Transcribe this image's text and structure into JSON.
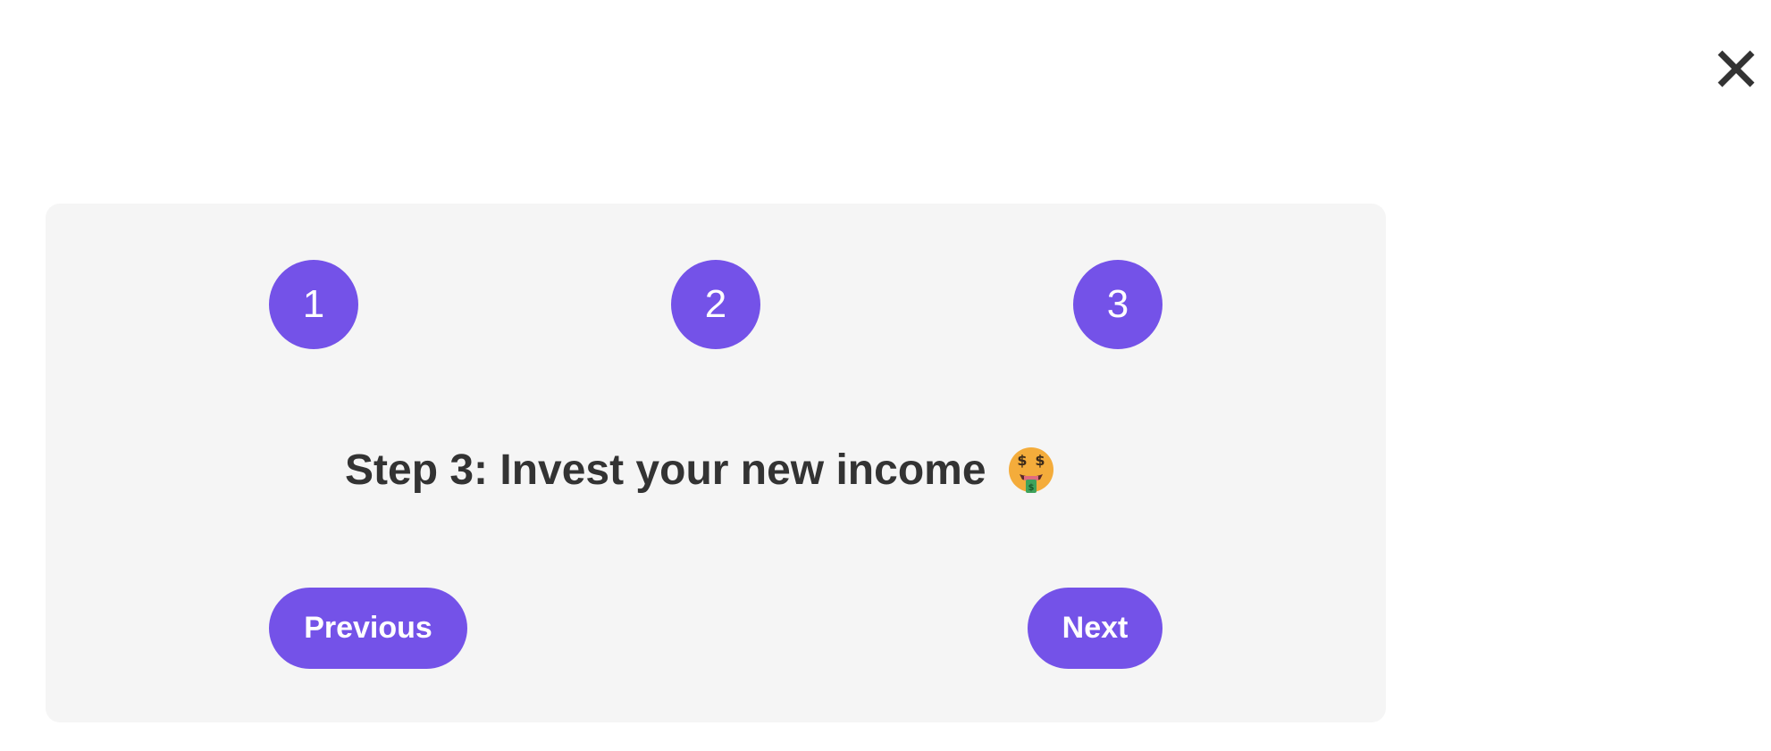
{
  "dialog": {
    "close_icon": "close-icon"
  },
  "stepper": {
    "steps": [
      {
        "label": "1"
      },
      {
        "label": "2"
      },
      {
        "label": "3"
      }
    ],
    "accent_color": "#7452e8"
  },
  "content": {
    "heading": "Step 3: Invest your new income",
    "heading_emoji_icon": "money-mouth-face-icon"
  },
  "navigation": {
    "previous_label": "Previous",
    "next_label": "Next"
  },
  "colors": {
    "card_background": "#f5f5f5",
    "text": "#333333",
    "button": "#7452e8"
  }
}
